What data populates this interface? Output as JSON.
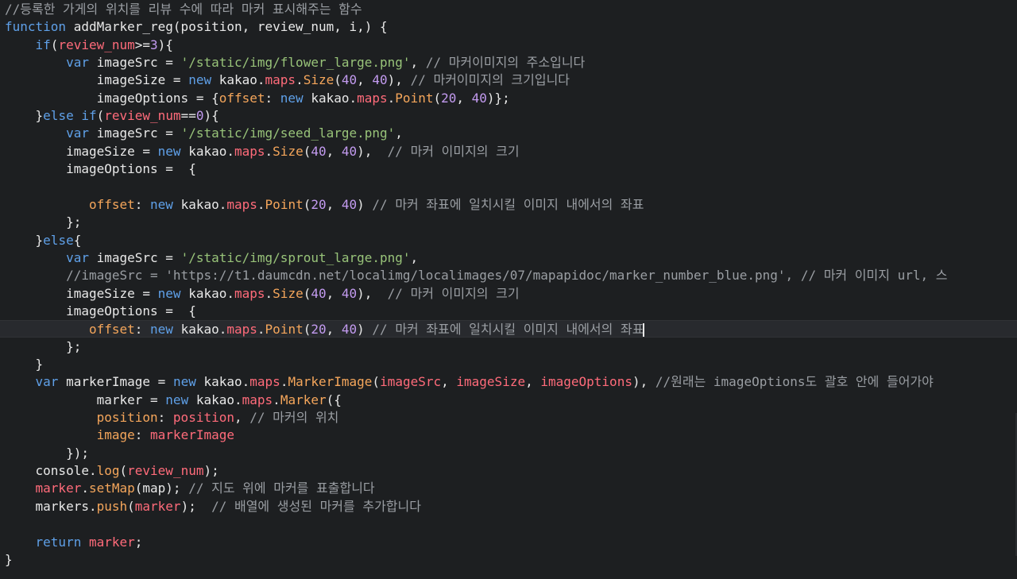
{
  "colors": {
    "background": "#1d1f21",
    "current_line": "#282a2e",
    "plain": "#e8e8e8",
    "comment": "#9a9ea3",
    "keyword": "#5fa0e8",
    "string": "#98c379",
    "number": "#c39bf0",
    "property": "#f5a65b",
    "variable": "#ff6b7a",
    "cursor": "#e8e8e8"
  },
  "editor": {
    "current_line_index": 18,
    "cursor_line_index": 18,
    "lines": [
      [
        [
          "//등록한 가게의 위치를 리뷰 수에 따라 마커 표시해주는 함수",
          "comment"
        ]
      ],
      [
        [
          "function",
          "keyword"
        ],
        [
          " addMarker_reg(position, review_num, i,) {",
          "plain"
        ]
      ],
      [
        [
          "    ",
          "plain"
        ],
        [
          "if",
          "keyword"
        ],
        [
          "(",
          "plain"
        ],
        [
          "review_num",
          "variable"
        ],
        [
          ">=",
          "plain"
        ],
        [
          "3",
          "number"
        ],
        [
          "){",
          "plain"
        ]
      ],
      [
        [
          "        ",
          "plain"
        ],
        [
          "var",
          "keyword"
        ],
        [
          " imageSrc = ",
          "plain"
        ],
        [
          "'/static/img/flower_large.png'",
          "string"
        ],
        [
          ", ",
          "plain"
        ],
        [
          "// 마커이미지의 주소입니다",
          "comment"
        ]
      ],
      [
        [
          "            imageSize = ",
          "plain"
        ],
        [
          "new",
          "keyword"
        ],
        [
          " kakao.",
          "plain"
        ],
        [
          "maps",
          "variable"
        ],
        [
          ".",
          "plain"
        ],
        [
          "Size",
          "property"
        ],
        [
          "(",
          "plain"
        ],
        [
          "40",
          "number"
        ],
        [
          ", ",
          "plain"
        ],
        [
          "40",
          "number"
        ],
        [
          "), ",
          "plain"
        ],
        [
          "// 마커이미지의 크기입니다",
          "comment"
        ]
      ],
      [
        [
          "            imageOptions = {",
          "plain"
        ],
        [
          "offset",
          "property"
        ],
        [
          ": ",
          "plain"
        ],
        [
          "new",
          "keyword"
        ],
        [
          " kakao.",
          "plain"
        ],
        [
          "maps",
          "variable"
        ],
        [
          ".",
          "plain"
        ],
        [
          "Point",
          "property"
        ],
        [
          "(",
          "plain"
        ],
        [
          "20",
          "number"
        ],
        [
          ", ",
          "plain"
        ],
        [
          "40",
          "number"
        ],
        [
          ")};",
          "plain"
        ]
      ],
      [
        [
          "    }",
          "plain"
        ],
        [
          "else",
          "keyword"
        ],
        [
          " ",
          "plain"
        ],
        [
          "if",
          "keyword"
        ],
        [
          "(",
          "plain"
        ],
        [
          "review_num",
          "variable"
        ],
        [
          "==",
          "plain"
        ],
        [
          "0",
          "number"
        ],
        [
          "){",
          "plain"
        ]
      ],
      [
        [
          "        ",
          "plain"
        ],
        [
          "var",
          "keyword"
        ],
        [
          " imageSrc = ",
          "plain"
        ],
        [
          "'/static/img/seed_large.png'",
          "string"
        ],
        [
          ",",
          "plain"
        ]
      ],
      [
        [
          "        imageSize = ",
          "plain"
        ],
        [
          "new",
          "keyword"
        ],
        [
          " kakao.",
          "plain"
        ],
        [
          "maps",
          "variable"
        ],
        [
          ".",
          "plain"
        ],
        [
          "Size",
          "property"
        ],
        [
          "(",
          "plain"
        ],
        [
          "40",
          "number"
        ],
        [
          ", ",
          "plain"
        ],
        [
          "40",
          "number"
        ],
        [
          "),  ",
          "plain"
        ],
        [
          "// 마커 이미지의 크기",
          "comment"
        ]
      ],
      [
        [
          "        imageOptions =  {",
          "plain"
        ]
      ],
      [
        [
          "",
          "plain"
        ]
      ],
      [
        [
          "           ",
          "plain"
        ],
        [
          "offset",
          "property"
        ],
        [
          ": ",
          "plain"
        ],
        [
          "new",
          "keyword"
        ],
        [
          " kakao.",
          "plain"
        ],
        [
          "maps",
          "variable"
        ],
        [
          ".",
          "plain"
        ],
        [
          "Point",
          "property"
        ],
        [
          "(",
          "plain"
        ],
        [
          "20",
          "number"
        ],
        [
          ", ",
          "plain"
        ],
        [
          "40",
          "number"
        ],
        [
          ") ",
          "plain"
        ],
        [
          "// 마커 좌표에 일치시킬 이미지 내에서의 좌표",
          "comment"
        ]
      ],
      [
        [
          "        };",
          "plain"
        ]
      ],
      [
        [
          "    }",
          "plain"
        ],
        [
          "else",
          "keyword"
        ],
        [
          "{",
          "plain"
        ]
      ],
      [
        [
          "        ",
          "plain"
        ],
        [
          "var",
          "keyword"
        ],
        [
          " imageSrc = ",
          "plain"
        ],
        [
          "'/static/img/sprout_large.png'",
          "string"
        ],
        [
          ",",
          "plain"
        ]
      ],
      [
        [
          "        ",
          "plain"
        ],
        [
          "//imageSrc = 'https://t1.daumcdn.net/localimg/localimages/07/mapapidoc/marker_number_blue.png', // 마커 이미지 url, 스",
          "comment"
        ]
      ],
      [
        [
          "        imageSize = ",
          "plain"
        ],
        [
          "new",
          "keyword"
        ],
        [
          " kakao.",
          "plain"
        ],
        [
          "maps",
          "variable"
        ],
        [
          ".",
          "plain"
        ],
        [
          "Size",
          "property"
        ],
        [
          "(",
          "plain"
        ],
        [
          "40",
          "number"
        ],
        [
          ", ",
          "plain"
        ],
        [
          "40",
          "number"
        ],
        [
          "),  ",
          "plain"
        ],
        [
          "// 마커 이미지의 크기",
          "comment"
        ]
      ],
      [
        [
          "        imageOptions =  {",
          "plain"
        ]
      ],
      [
        [
          "           ",
          "plain"
        ],
        [
          "offset",
          "property"
        ],
        [
          ": ",
          "plain"
        ],
        [
          "new",
          "keyword"
        ],
        [
          " kakao.",
          "plain"
        ],
        [
          "maps",
          "variable"
        ],
        [
          ".",
          "plain"
        ],
        [
          "Point",
          "property"
        ],
        [
          "(",
          "plain"
        ],
        [
          "20",
          "number"
        ],
        [
          ", ",
          "plain"
        ],
        [
          "40",
          "number"
        ],
        [
          ") ",
          "plain"
        ],
        [
          "// 마커 좌표에 일치시킬 이미지 내에서의 좌표",
          "comment"
        ]
      ],
      [
        [
          "        };",
          "plain"
        ]
      ],
      [
        [
          "    }",
          "plain"
        ]
      ],
      [
        [
          "    ",
          "plain"
        ],
        [
          "var",
          "keyword"
        ],
        [
          " markerImage = ",
          "plain"
        ],
        [
          "new",
          "keyword"
        ],
        [
          " kakao.",
          "plain"
        ],
        [
          "maps",
          "variable"
        ],
        [
          ".",
          "plain"
        ],
        [
          "MarkerImage",
          "property"
        ],
        [
          "(",
          "plain"
        ],
        [
          "imageSrc",
          "variable"
        ],
        [
          ", ",
          "plain"
        ],
        [
          "imageSize",
          "variable"
        ],
        [
          ", ",
          "plain"
        ],
        [
          "imageOptions",
          "variable"
        ],
        [
          "), ",
          "plain"
        ],
        [
          "//원래는 imageOptions도 괄호 안에 들어가야",
          "comment"
        ]
      ],
      [
        [
          "            marker = ",
          "plain"
        ],
        [
          "new",
          "keyword"
        ],
        [
          " kakao.",
          "plain"
        ],
        [
          "maps",
          "variable"
        ],
        [
          ".",
          "plain"
        ],
        [
          "Marker",
          "property"
        ],
        [
          "({",
          "plain"
        ]
      ],
      [
        [
          "            ",
          "plain"
        ],
        [
          "position",
          "property"
        ],
        [
          ": ",
          "plain"
        ],
        [
          "position",
          "variable"
        ],
        [
          ", ",
          "plain"
        ],
        [
          "// 마커의 위치",
          "comment"
        ]
      ],
      [
        [
          "            ",
          "plain"
        ],
        [
          "image",
          "property"
        ],
        [
          ": ",
          "plain"
        ],
        [
          "markerImage",
          "variable"
        ]
      ],
      [
        [
          "        });",
          "plain"
        ]
      ],
      [
        [
          "    console.",
          "plain"
        ],
        [
          "log",
          "property"
        ],
        [
          "(",
          "plain"
        ],
        [
          "review_num",
          "variable"
        ],
        [
          ");",
          "plain"
        ]
      ],
      [
        [
          "    ",
          "plain"
        ],
        [
          "marker",
          "variable"
        ],
        [
          ".",
          "plain"
        ],
        [
          "setMap",
          "property"
        ],
        [
          "(map); ",
          "plain"
        ],
        [
          "// 지도 위에 마커를 표출합니다",
          "comment"
        ]
      ],
      [
        [
          "    markers.",
          "plain"
        ],
        [
          "push",
          "property"
        ],
        [
          "(",
          "plain"
        ],
        [
          "marker",
          "variable"
        ],
        [
          ");  ",
          "plain"
        ],
        [
          "// 배열에 생성된 마커를 추가합니다",
          "comment"
        ]
      ],
      [
        [
          "",
          "plain"
        ]
      ],
      [
        [
          "    ",
          "plain"
        ],
        [
          "return",
          "keyword"
        ],
        [
          " ",
          "plain"
        ],
        [
          "marker",
          "variable"
        ],
        [
          ";",
          "plain"
        ]
      ],
      [
        [
          "}",
          "plain"
        ]
      ]
    ]
  }
}
